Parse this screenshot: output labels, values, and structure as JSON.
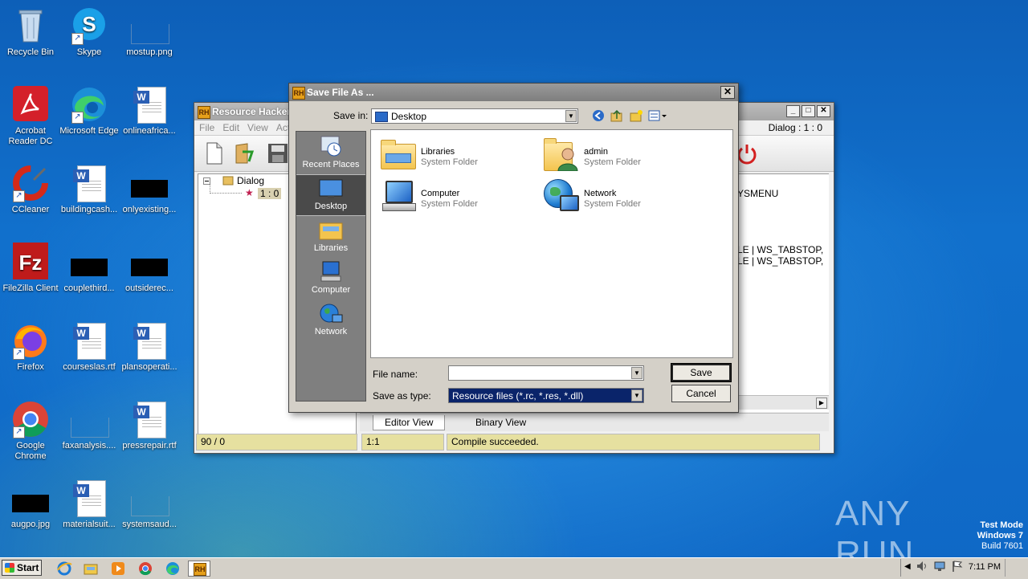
{
  "desktop": {
    "icons": [
      {
        "label": "Recycle Bin"
      },
      {
        "label": "Skype"
      },
      {
        "label": "mostup.png"
      },
      {
        "label": "Acrobat Reader DC"
      },
      {
        "label": "Microsoft Edge"
      },
      {
        "label": "onlineafrica..."
      },
      {
        "label": "CCleaner"
      },
      {
        "label": "buildingcash..."
      },
      {
        "label": "onlyexisting..."
      },
      {
        "label": "FileZilla Client"
      },
      {
        "label": "couplethird..."
      },
      {
        "label": "outsiderec..."
      },
      {
        "label": "Firefox"
      },
      {
        "label": "courseslas.rtf"
      },
      {
        "label": "plansoperati..."
      },
      {
        "label": "Google Chrome"
      },
      {
        "label": "faxanalysis...."
      },
      {
        "label": "pressrepair.rtf"
      },
      {
        "label": "augpo.jpg"
      },
      {
        "label": "materialsuit..."
      },
      {
        "label": "systemsaud..."
      }
    ]
  },
  "rh_window": {
    "title": "Resource Hacker",
    "menu": [
      "File",
      "Edit",
      "View",
      "Acti"
    ],
    "dialog_label": "Dialog : 1 : 0",
    "tree": {
      "root": "Dialog",
      "child": "1 : 0"
    },
    "editor_lines": [
      "YSMENU",
      "LE | WS_TABSTOP,",
      "LE | WS_TABSTOP,"
    ],
    "tabs": {
      "editor": "Editor View",
      "binary": "Binary View"
    },
    "status": {
      "count": "90 / 0",
      "pos": "1:1",
      "message": "Compile succeeded."
    }
  },
  "save_dialog": {
    "title": "Save File As ...",
    "save_in_label": "Save in:",
    "save_in_value": "Desktop",
    "places": [
      "Recent Places",
      "Desktop",
      "Libraries",
      "Computer",
      "Network"
    ],
    "items": [
      {
        "name": "Libraries",
        "type": "System Folder"
      },
      {
        "name": "admin",
        "type": "System Folder"
      },
      {
        "name": "Computer",
        "type": "System Folder"
      },
      {
        "name": "Network",
        "type": "System Folder"
      }
    ],
    "file_name_label": "File name:",
    "file_name_value": "",
    "save_as_type_label": "Save as type:",
    "save_as_type_value": "Resource files (*.rc, *.res, *.dll)",
    "save_button": "Save",
    "cancel_button": "Cancel"
  },
  "taskbar": {
    "start": "Start",
    "clock": "7:11 PM"
  },
  "overlay": {
    "watermark": "ANY RUN",
    "test_mode": "Test Mode",
    "os": "Windows 7",
    "build": "Build 7601"
  }
}
